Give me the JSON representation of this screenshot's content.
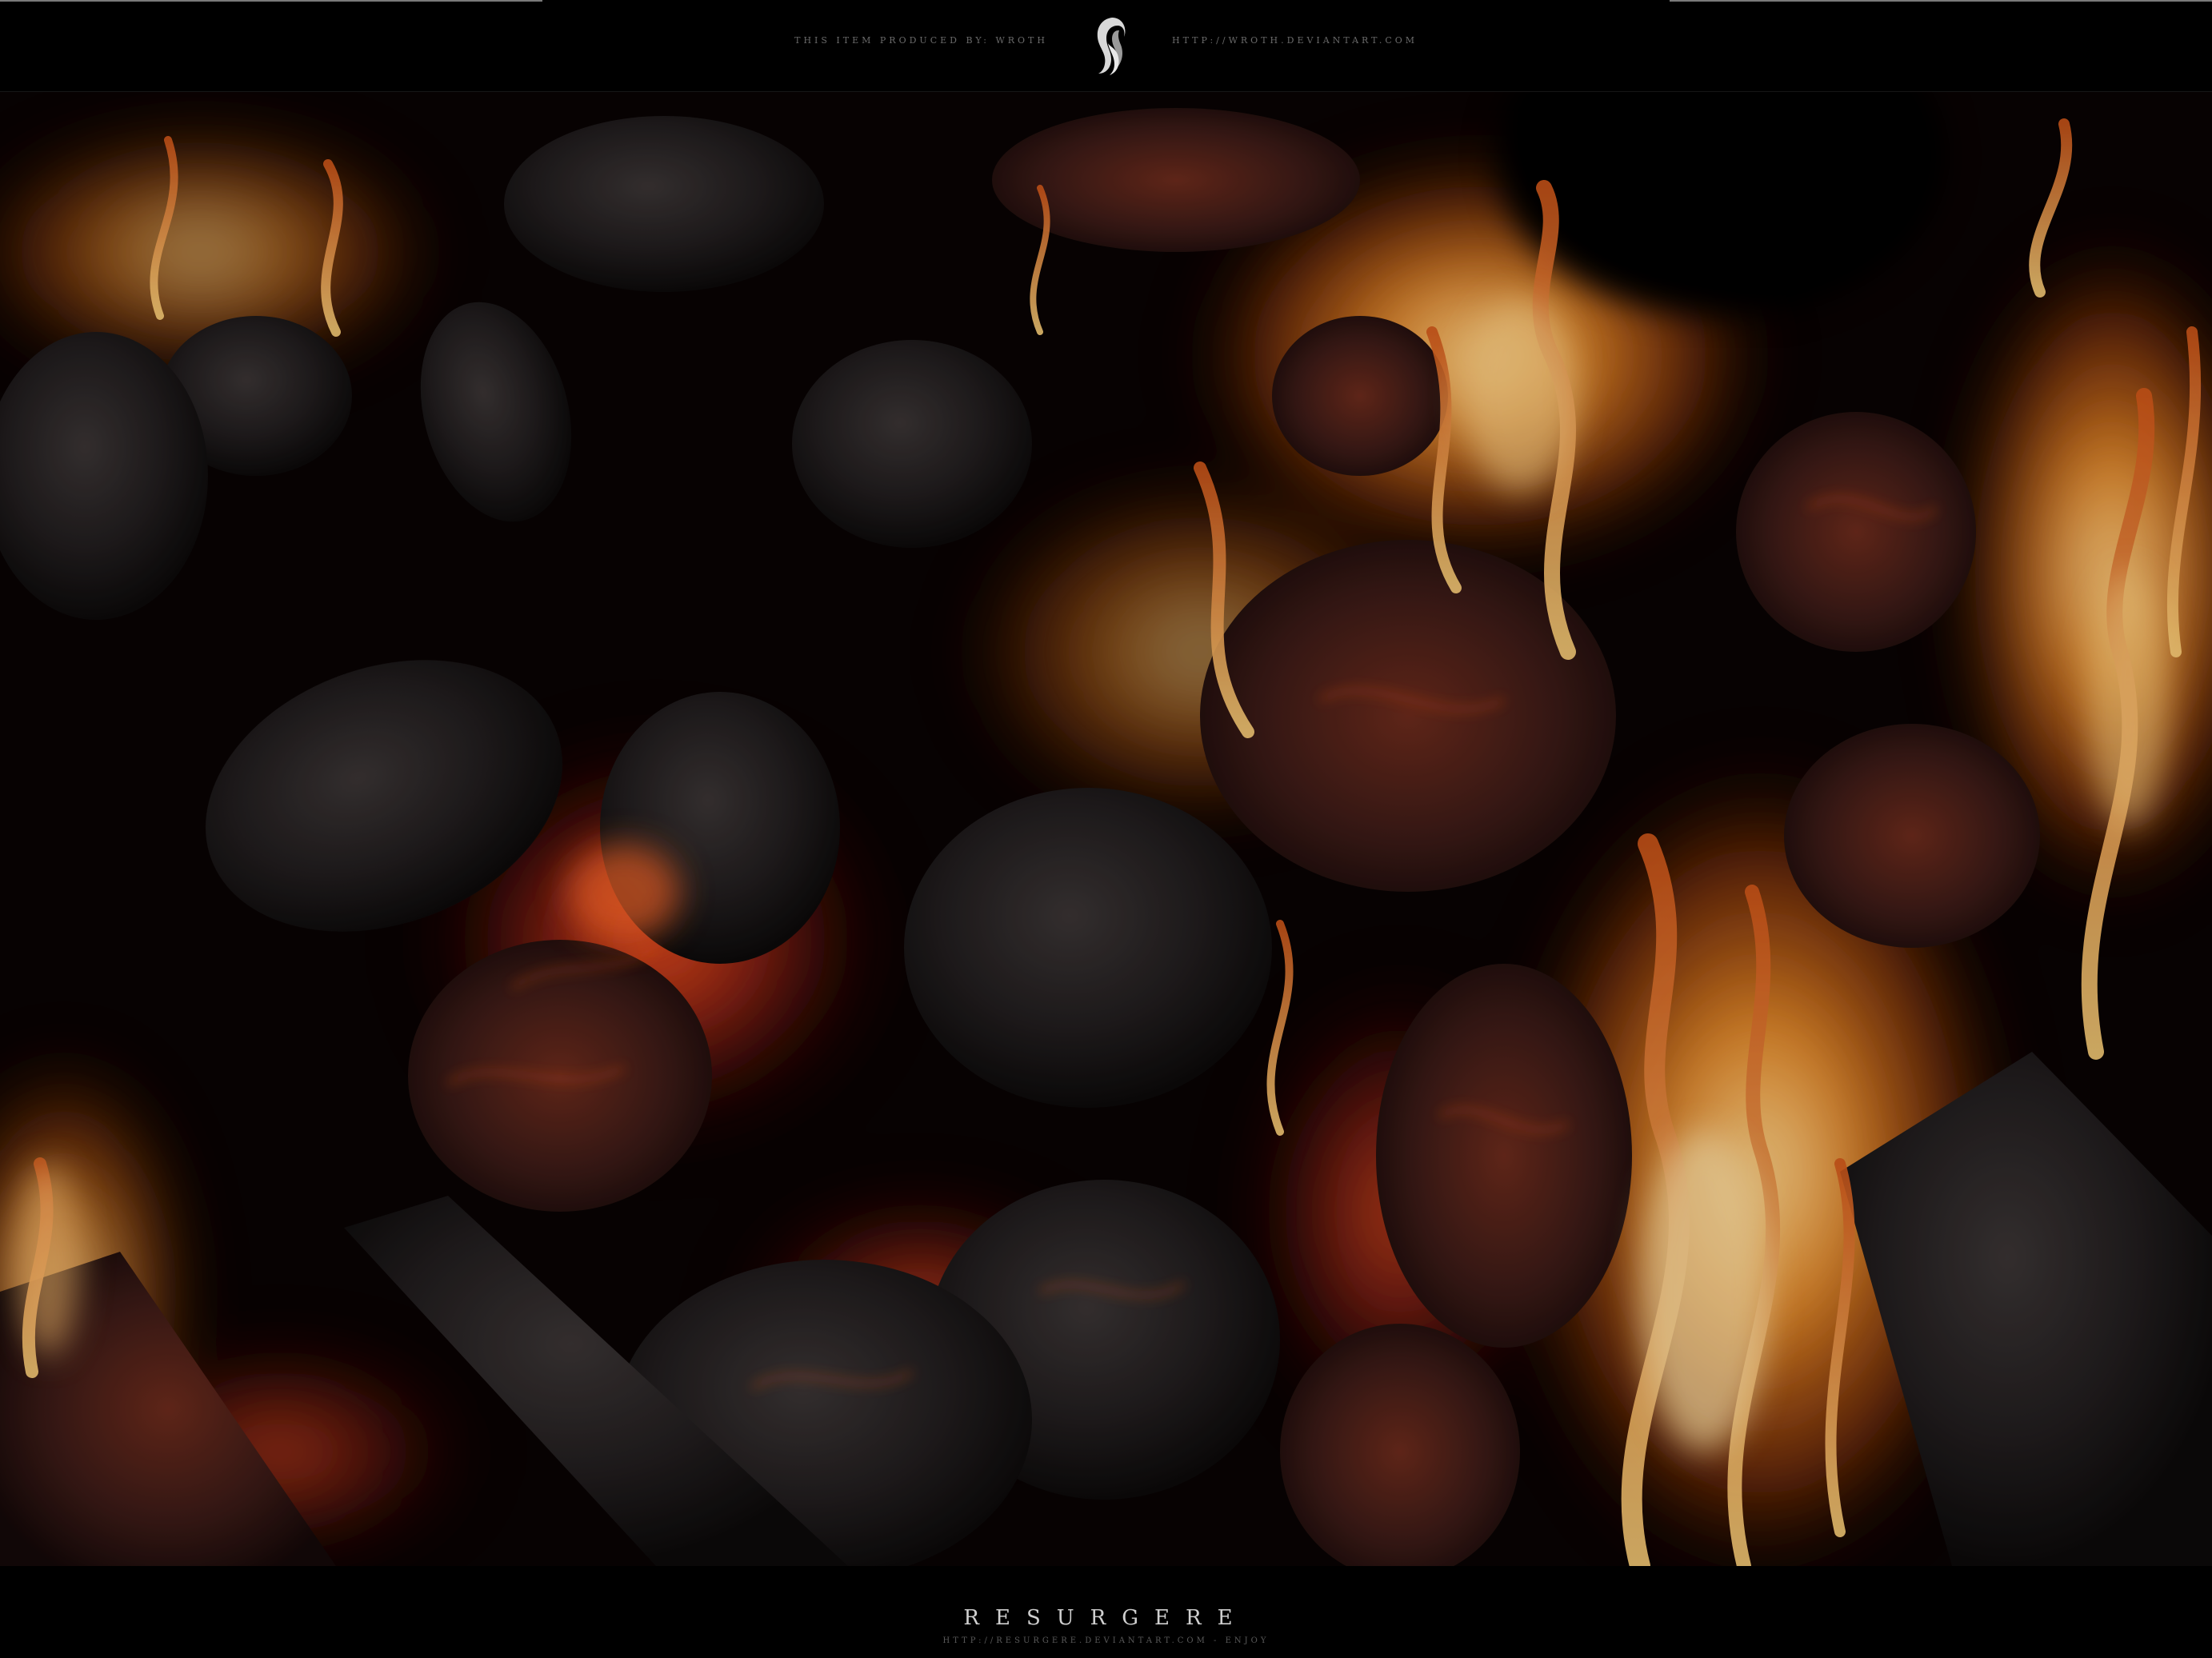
{
  "header": {
    "credit_left": "THIS ITEM PRODUCED BY: WROTH",
    "credit_right": "HTTP://WROTH.DEVIANTART.COM"
  },
  "footer": {
    "title": "RESURGERE",
    "url": "HTTP://RESURGERE.DEVIANTART.COM - ENJOY"
  },
  "colors": {
    "background": "#000000",
    "flame": "#f08a24",
    "ember": "#c8361a",
    "charcoal": "#1c1a1a"
  }
}
